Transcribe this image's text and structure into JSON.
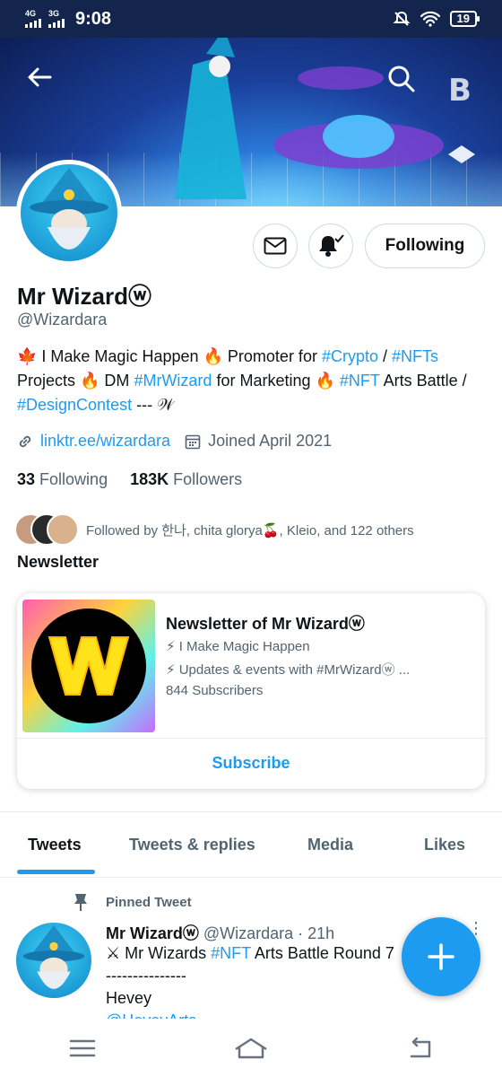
{
  "status": {
    "net1": "4G",
    "net2": "3G",
    "time": "9:08",
    "battery": "19"
  },
  "profile": {
    "name": "Mr Wizardⓦ",
    "handle": "@Wizardara",
    "bio": [
      {
        "t": "🍁 I Make Magic Happen  🔥 Promoter for ",
        "link": false
      },
      {
        "t": "#Crypto",
        "link": true
      },
      {
        "t": " / ",
        "link": false
      },
      {
        "t": "#NFTs",
        "link": true
      },
      {
        "t": " Projects 🔥 DM ",
        "link": false
      },
      {
        "t": "#MrWizard",
        "link": true
      },
      {
        "t": " for Marketing 🔥 ",
        "link": false
      },
      {
        "t": "#NFT",
        "link": true
      },
      {
        "t": " Arts Battle / ",
        "link": false
      },
      {
        "t": "#DesignContest",
        "link": true
      },
      {
        "t": "  --- 𝒲",
        "link": false
      }
    ],
    "website": "linktr.ee/wizardara",
    "joined": "Joined April 2021",
    "following_count": "33",
    "following_label": "Following",
    "followers_count": "183K",
    "followers_label": "Followers",
    "followed_by": "Followed by 한나, chita glorya🍒, Kleio, and 122 others",
    "follow_button": "Following"
  },
  "newsletter": {
    "section": "Newsletter",
    "title": "Newsletter of Mr Wizardⓦ",
    "line1": "⚡ I Make Magic Happen",
    "line2": "⚡ Updates & events with #MrWizardⓦ ...",
    "subscribers": "844 Subscribers",
    "subscribe": "Subscribe"
  },
  "tabs": [
    "Tweets",
    "Tweets & replies",
    "Media",
    "Likes"
  ],
  "tweet": {
    "pinned": "Pinned Tweet",
    "name": "Mr Wizardⓦ",
    "handle_time": "@Wizardara · 21h",
    "line1_pre": "⚔ Mr Wizards ",
    "line1_tag": "#NFT",
    "line1_post": " Arts Battle Round 7",
    "line2": "---------------",
    "line3": "Hevey",
    "line4": "@HeveyArts"
  },
  "colors": {
    "accent": "#1d9bf0",
    "statusbar": "#13244d"
  }
}
